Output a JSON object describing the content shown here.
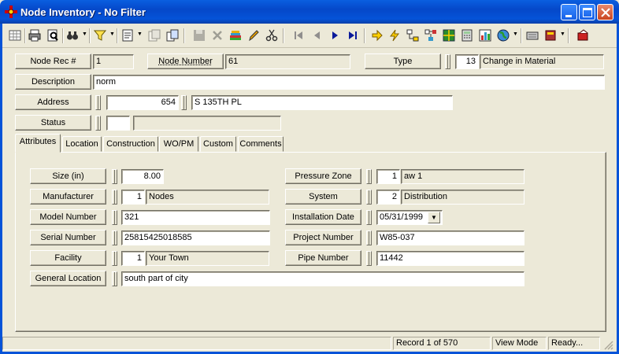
{
  "window": {
    "title": "Node Inventory - No Filter",
    "icons": {
      "app": "nodes-icon",
      "minimize": "minimize-icon",
      "maximize": "maximize-icon",
      "close": "close-icon"
    }
  },
  "toolbar": {
    "icons": [
      "grid-icon",
      "print-icon",
      "print-preview-icon",
      "binoculars-icon",
      "filter-icon",
      "form-icon",
      "copy-record-icon",
      "clone-icon",
      "save-icon",
      "delete-icon",
      "books-icon",
      "pencil-icon",
      "scissors-icon",
      "first-record-icon",
      "previous-record-icon",
      "next-record-icon",
      "last-record-icon",
      "goto-arrow-icon",
      "lightning-icon",
      "hierarchy-icon",
      "network-icon",
      "map-icon",
      "calculator-icon",
      "chart-icon",
      "globe-icon",
      "keyboard-icon",
      "book-icon",
      "exit-icon"
    ]
  },
  "header": {
    "node_rec_label": "Node Rec #",
    "node_rec_value": "1",
    "node_number_label": "Node Number",
    "node_number_value": "61",
    "type_label": "Type",
    "type_code": "13",
    "type_desc": "Change in Material",
    "description_label": "Description",
    "description_value": "norm",
    "address_label": "Address",
    "address_number": "654",
    "address_street": "S 135TH PL",
    "status_label": "Status",
    "status_code": "",
    "status_desc": ""
  },
  "tabs": [
    {
      "label": "Attributes",
      "active": true
    },
    {
      "label": "Location",
      "active": false
    },
    {
      "label": "Construction",
      "active": false
    },
    {
      "label": "WO/PM",
      "active": false
    },
    {
      "label": "Custom",
      "active": false
    },
    {
      "label": "Comments",
      "active": false
    }
  ],
  "attributes": {
    "size_label": "Size (in)",
    "size_value": "8.00",
    "manufacturer_label": "Manufacturer",
    "manufacturer_code": "1",
    "manufacturer_desc": "Nodes",
    "model_label": "Model Number",
    "model_value": "321",
    "serial_label": "Serial Number",
    "serial_value": "25815425018585",
    "facility_label": "Facility",
    "facility_code": "1",
    "facility_desc": "Your Town",
    "general_location_label": "General Location",
    "general_location_value": "south part of city",
    "pressure_zone_label": "Pressure Zone",
    "pressure_zone_code": "1",
    "pressure_zone_desc": "aw 1",
    "system_label": "System",
    "system_code": "2",
    "system_desc": "Distribution",
    "install_date_label": "Installation Date",
    "install_date_value": "05/31/1999",
    "project_label": "Project Number",
    "project_value": "W85-037",
    "pipe_label": "Pipe Number",
    "pipe_value": "11442"
  },
  "statusbar": {
    "record": "Record 1 of 570",
    "mode": "View Mode",
    "state": "Ready..."
  }
}
